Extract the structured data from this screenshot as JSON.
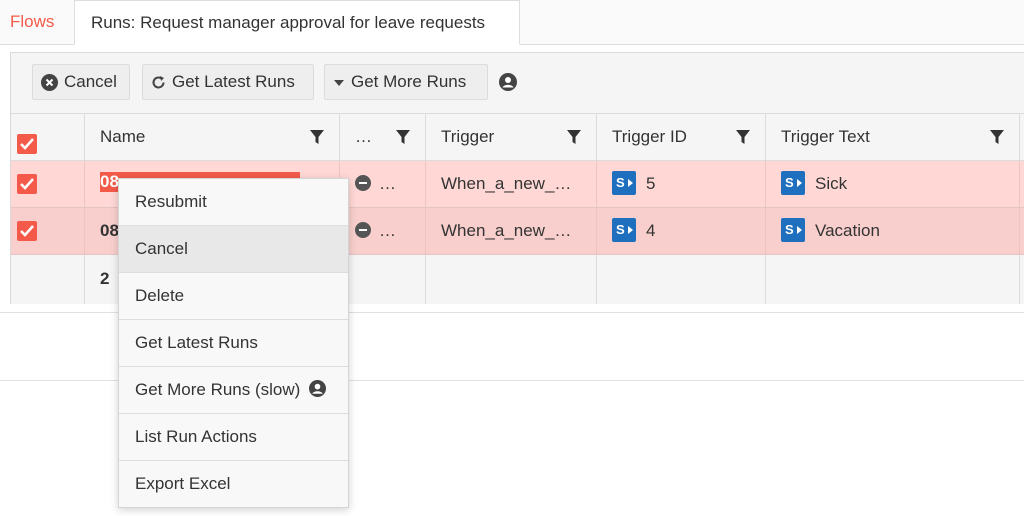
{
  "tabs": {
    "flows": "Flows",
    "runs": "Runs: Request manager approval for leave requests"
  },
  "toolbar": {
    "cancel": "Cancel",
    "get_latest_runs": "Get Latest Runs",
    "get_more_runs": "Get More Runs"
  },
  "columns": {
    "name": "Name",
    "status": "…",
    "trigger": "Trigger",
    "trigger_id": "Trigger ID",
    "trigger_text": "Trigger Text"
  },
  "rows": [
    {
      "name": "08",
      "status": "…",
      "trigger": "When_a_new_…",
      "trigger_id": "5",
      "trigger_text": "Sick"
    },
    {
      "name": "08",
      "status": "…",
      "trigger": "When_a_new_…",
      "trigger_id": "4",
      "trigger_text": "Vacation"
    }
  ],
  "footer": {
    "count": "2"
  },
  "context_menu": {
    "resubmit": "Resubmit",
    "cancel": "Cancel",
    "delete": "Delete",
    "get_latest_runs": "Get Latest Runs",
    "get_more_runs_slow": "Get More Runs (slow)",
    "list_run_actions": "List Run Actions",
    "export_excel": "Export Excel"
  },
  "colors": {
    "accent": "#f35a4a",
    "selected_row": "#ffd8d6",
    "sharepoint": "#1f6fbf"
  }
}
